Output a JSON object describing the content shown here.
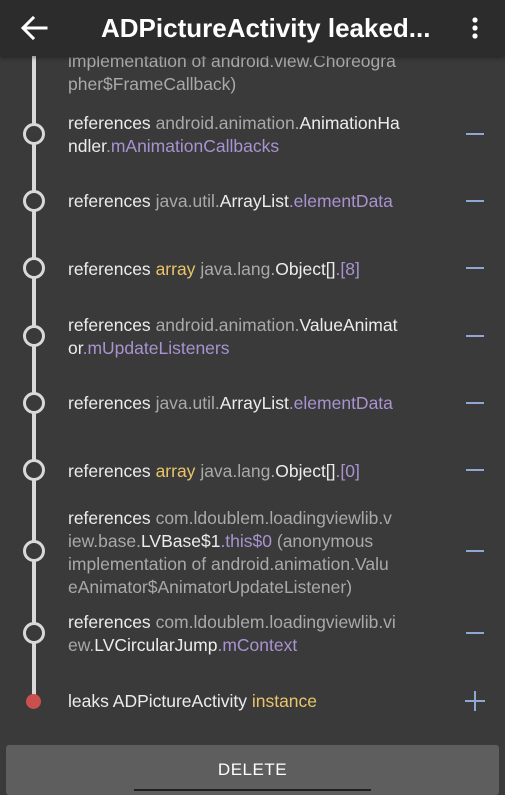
{
  "app_bar": {
    "title": "ADPictureActivity leaked..."
  },
  "icons": {
    "back": "arrow-left-icon",
    "more": "more-vertical-icon"
  },
  "partial_row": {
    "line1": "implementation of android.view.Choreogra",
    "line2": "pher$FrameCallback)"
  },
  "rows": [
    {
      "label": "references",
      "pkg": "android.animation.",
      "cls": "AnimationHa",
      "cls2": "ndler",
      "field": ".mAnimationCallbacks",
      "toggle": "−"
    },
    {
      "label": "references",
      "pkg": "java.util.",
      "cls": "ArrayList",
      "field": ".elementData",
      "toggle": "−"
    },
    {
      "label": "references",
      "type": "array",
      "pkg": "java.lang.",
      "cls": "Object[]",
      "field": ".[8]",
      "toggle": "−"
    },
    {
      "label": "references",
      "pkg": "android.animation.",
      "cls": "ValueAnimat",
      "cls2": "or",
      "field": ".mUpdateListeners",
      "toggle": "−"
    },
    {
      "label": "references",
      "pkg": "java.util.",
      "cls": "ArrayList",
      "field": ".elementData",
      "toggle": "−"
    },
    {
      "label": "references",
      "type": "array",
      "pkg": "java.lang.",
      "cls": "Object[]",
      "field": ".[0]",
      "toggle": "−"
    },
    {
      "label": "references",
      "pkg": "com.ldoublem.loadingviewlib.v",
      "pkg2": "iew.base.",
      "cls": "LVBase$1",
      "field": ".this$0",
      "note1": "(anonymous",
      "note2": "implementation of android.animation.Valu",
      "note3": "eAnimator$AnimatorUpdateListener)",
      "toggle": "−"
    },
    {
      "label": "references",
      "pkg": "com.ldoublem.loadingviewlib.vi",
      "pkg2": "ew.",
      "cls": "LVCircularJump",
      "field": ".mContext",
      "toggle": "−"
    }
  ],
  "leak_row": {
    "label": "leaks",
    "cls": "ADPictureActivity",
    "suffix": "instance",
    "toggle": "+"
  },
  "footer": {
    "delete_label": "DELETE"
  },
  "colors": {
    "app_bar": "#2c2c2c",
    "background": "#3a3a3a",
    "field": "#a893d0",
    "array_keyword": "#e9c46a",
    "toggle": "#8fa8d3",
    "leak_node": "#c9504d"
  }
}
